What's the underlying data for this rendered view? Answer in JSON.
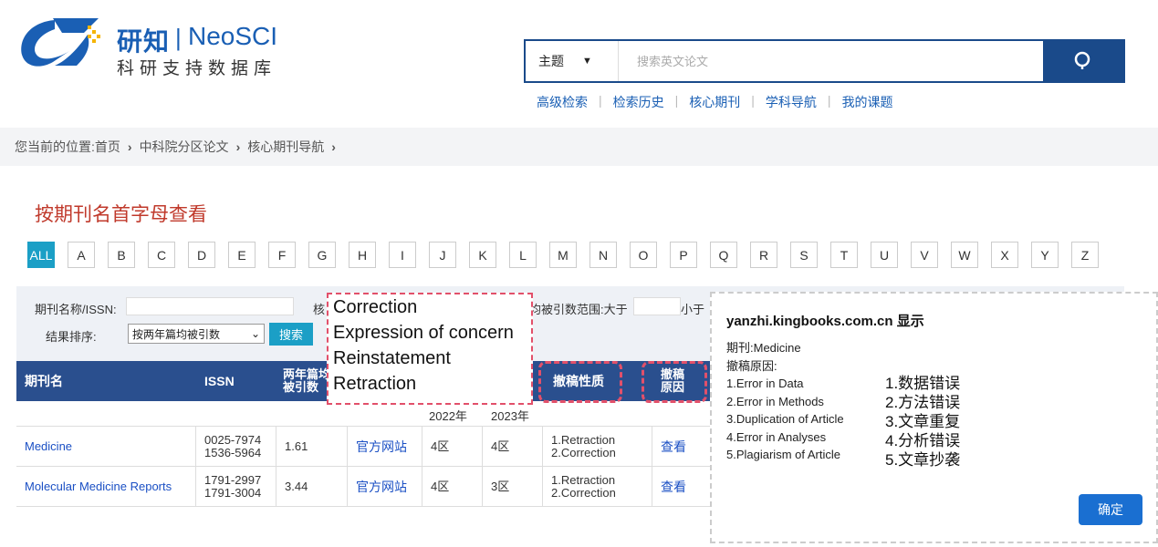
{
  "logo": {
    "cn_name": "研知",
    "separator": "|",
    "en_name": "NeoSCI",
    "subtitle": "科研支持数据库"
  },
  "search": {
    "scope": "主题",
    "placeholder": "搜索英文论文"
  },
  "top_links": [
    "高级检索",
    "检索历史",
    "核心期刊",
    "学科导航",
    "我的课题"
  ],
  "breadcrumb": {
    "prefix": "您当前的位置:",
    "items": [
      "首页",
      "中科院分区论文",
      "核心期刊导航"
    ]
  },
  "section_title": "按期刊名首字母查看",
  "letters": [
    "ALL",
    "A",
    "B",
    "C",
    "D",
    "E",
    "F",
    "G",
    "H",
    "I",
    "J",
    "K",
    "L",
    "M",
    "N",
    "O",
    "P",
    "Q",
    "R",
    "S",
    "T",
    "U",
    "V",
    "W",
    "X",
    "Y",
    "Z"
  ],
  "filter": {
    "name_label": "期刊名称/ISSN:",
    "core_label": "核",
    "range_label": "均被引数范围:大于",
    "less_label": "小于",
    "sort_label": "结果排序:",
    "sort_value": "按两年篇均被引数",
    "search_button": "搜索"
  },
  "table": {
    "headers": {
      "name": "期刊名",
      "issn": "ISSN",
      "cites": "两年篇均被引数",
      "cites_l1": "两年篇均",
      "cites_l2": "被引数",
      "nature": "撤稿性质",
      "reason_l1": "撤稿",
      "reason_l2": "原因"
    },
    "sub_years": [
      "2022年",
      "2023年"
    ],
    "rows": [
      {
        "name": "Medicine",
        "issn1": "0025-7974",
        "issn2": "1536-5964",
        "cites": "1.61",
        "site": "官方网站",
        "y2022": "4区",
        "y2023": "4区",
        "nature1": "1.Retraction",
        "nature2": "2.Correction",
        "reason": "查看"
      },
      {
        "name": "Molecular Medicine Reports",
        "issn1": "1791-2997",
        "issn2": "1791-3004",
        "cites": "3.44",
        "site": "官方网站",
        "y2022": "4区",
        "y2023": "3区",
        "nature1": "1.Retraction",
        "nature2": "2.Correction",
        "reason": "查看"
      }
    ]
  },
  "retraction_types": [
    "Correction",
    "Expression of concern",
    "Reinstatement",
    "Retraction"
  ],
  "dialog": {
    "title": "yanzhi.kingbooks.com.cn 显示",
    "journal": "期刊:Medicine",
    "reason_label": "撤稿原因:",
    "reasons": [
      "1.Error in Data",
      "2.Error in Methods",
      "3.Duplication of Article",
      "4.Error in Analyses",
      "5.Plagiarism of Article"
    ],
    "reasons_cn": [
      "1.数据错误",
      "2.方法错误",
      "3.文章重复",
      "4.分析错误",
      "5.文章抄袭"
    ],
    "ok_button": "确定"
  },
  "colors": {
    "brand_blue": "#1a4a8a",
    "header_blue": "#2a4f8e",
    "accent_red": "#c0392b",
    "cyan": "#1b9fc6",
    "dash_pink": "#e2506a"
  }
}
